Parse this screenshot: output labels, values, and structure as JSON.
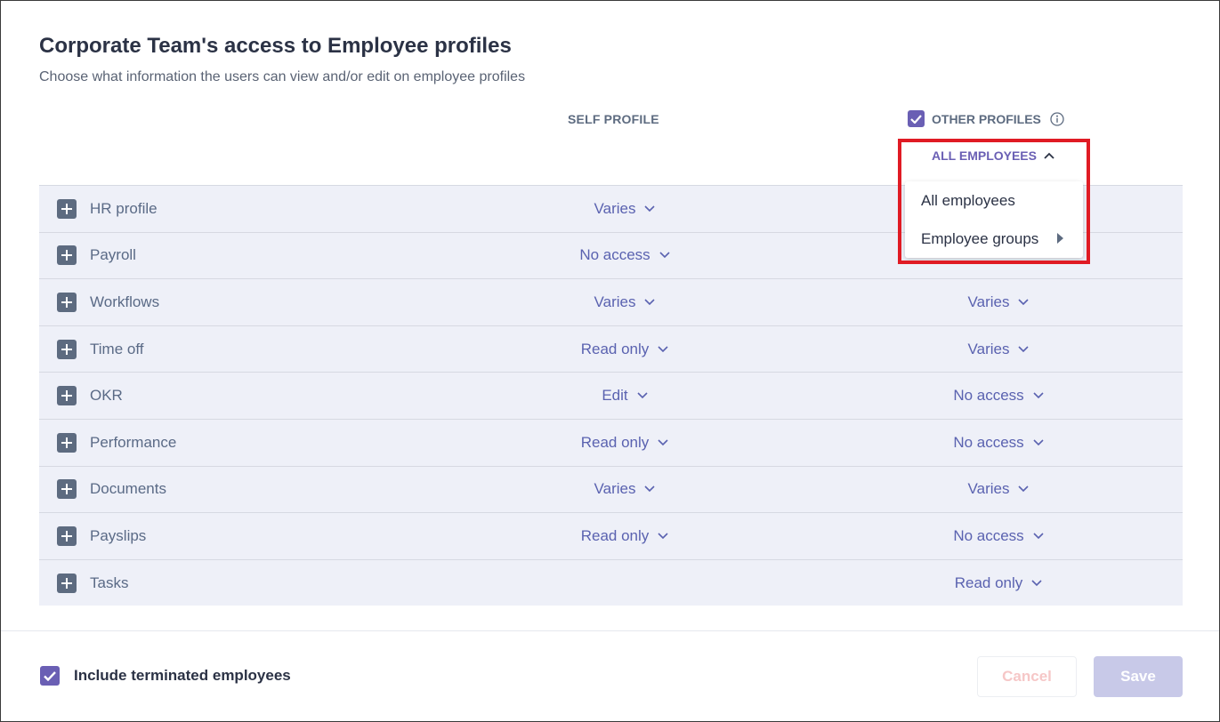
{
  "header": {
    "title": "Corporate Team's access to Employee profiles",
    "subtitle": "Choose what information the users can view and/or edit on employee profiles"
  },
  "columns": {
    "self": "SELF PROFILE",
    "other": "OTHER PROFILES",
    "other_checked": true,
    "scope_label": "ALL EMPLOYEES"
  },
  "rows": [
    {
      "label": "HR profile",
      "self": "Varies",
      "other": ""
    },
    {
      "label": "Payroll",
      "self": "No access",
      "other": ""
    },
    {
      "label": "Workflows",
      "self": "Varies",
      "other": "Varies"
    },
    {
      "label": "Time off",
      "self": "Read only",
      "other": "Varies"
    },
    {
      "label": "OKR",
      "self": "Edit",
      "other": "No access"
    },
    {
      "label": "Performance",
      "self": "Read only",
      "other": "No access"
    },
    {
      "label": "Documents",
      "self": "Varies",
      "other": "Varies"
    },
    {
      "label": "Payslips",
      "self": "Read only",
      "other": "No access"
    },
    {
      "label": "Tasks",
      "self": "",
      "other": "Read only"
    }
  ],
  "dropdown": {
    "items": [
      "All employees",
      "Employee groups"
    ]
  },
  "footer": {
    "include_terminated": "Include terminated employees",
    "include_terminated_checked": true,
    "cancel": "Cancel",
    "save": "Save"
  },
  "colors": {
    "accent": "#6a5fb4",
    "highlight": "#e01b24",
    "row_bg": "#eef0f8"
  }
}
